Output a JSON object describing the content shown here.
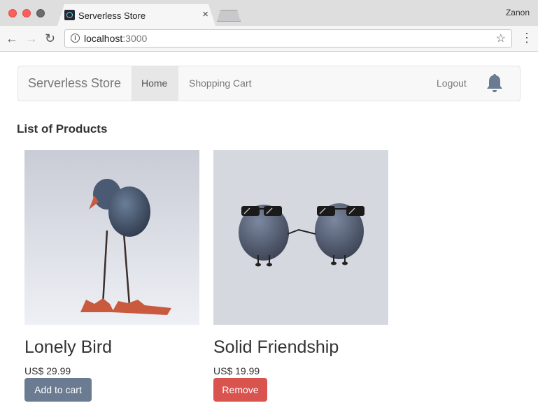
{
  "browser": {
    "tab_title": "Serverless Store",
    "tab_close": "×",
    "profile_name": "Zanon",
    "url_host": "localhost",
    "url_port": ":3000",
    "back_glyph": "←",
    "forward_glyph": "→",
    "reload_glyph": "↻",
    "star_glyph": "☆",
    "menu_glyph": "⋮",
    "info_glyph": "i"
  },
  "navbar": {
    "brand": "Serverless Store",
    "items": [
      {
        "label": "Home",
        "active": true
      },
      {
        "label": "Shopping Cart",
        "active": false
      }
    ],
    "logout_label": "Logout",
    "notification_icon": "bell-icon"
  },
  "main": {
    "title": "List of Products",
    "products": [
      {
        "name": "Lonely Bird",
        "price": "US$ 29.99",
        "button_label": "Add to cart",
        "button_color": "#6b7b92"
      },
      {
        "name": "Solid Friendship",
        "price": "US$ 19.99",
        "button_label": "Remove",
        "button_color": "#d9534f"
      }
    ]
  },
  "colors": {
    "navbar_bg": "#f8f8f8",
    "active_nav_bg": "#e7e7e7",
    "primary_button": "#6b7b92",
    "danger_button": "#d9534f"
  }
}
